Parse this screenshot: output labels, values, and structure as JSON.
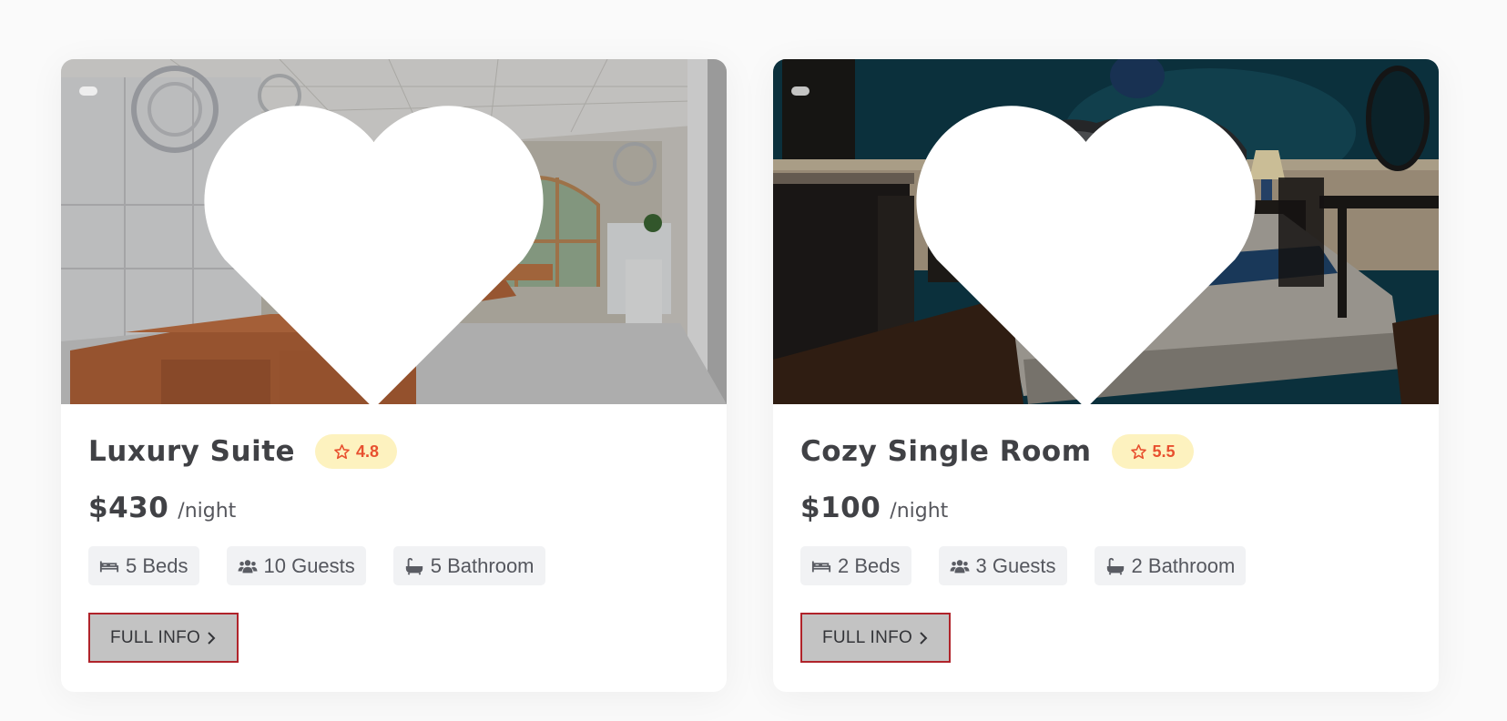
{
  "rooms": [
    {
      "title": "Luxury Suite",
      "rating": "4.8",
      "price": "$430",
      "per": "/night",
      "beds": "5 Beds",
      "guests": "10 Guests",
      "bathroom": "5 Bathroom",
      "button": "FULL INFO",
      "photo": "bright lounge with leather sofas and chandeliers"
    },
    {
      "title": "Cozy Single Room",
      "rating": "5.5",
      "price": "$100",
      "per": "/night",
      "beds": "2 Beds",
      "guests": "3 Guests",
      "bathroom": "2 Bathroom",
      "button": "FULL INFO",
      "photo": "dark teal bedroom with bed and bedside lamps"
    }
  ],
  "colors": {
    "rating_bg": "#fdf2bf",
    "rating_text": "#e8502f",
    "button_border": "#b0232a",
    "button_bg": "#c3c3c3",
    "feature_bg": "#f1f2f4"
  },
  "icons": [
    "heart-icon",
    "star-icon",
    "bed-icon",
    "guests-icon",
    "bathtub-icon",
    "chevron-right-icon"
  ]
}
